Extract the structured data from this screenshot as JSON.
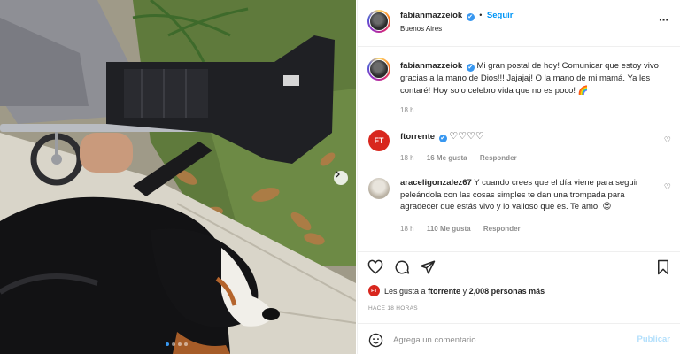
{
  "header": {
    "username": "fabianmazzeiok",
    "follow_label": "Seguir",
    "location": "Buenos Aires",
    "verified_icon": "✔"
  },
  "caption": {
    "username": "fabianmazzeiok",
    "text": "Mi gran postal de hoy! Comunicar que estoy vivo gracias a la mano de Dios!!! Jajajaj! O la mano de mi mamá. Ya les contaré! Hoy solo celebro vida que no es poco! 🌈",
    "time": "18 h"
  },
  "comments": [
    {
      "username": "ftorrente",
      "avatar_text": "FT",
      "text": "♡♡♡♡",
      "time": "18 h",
      "likes": "16 Me gusta",
      "reply_label": "Responder"
    },
    {
      "username": "araceligonzalez67",
      "text": "Y cuando crees que el día viene para seguir peleándola con las cosas simples te dan una trompada para agradecer que estás vivo y lo valioso que es. Te amo! 😍",
      "time": "18 h",
      "likes": "110 Me gusta",
      "reply_label": "Responder"
    }
  ],
  "likes_line": {
    "avatar_text": "FT",
    "prefix": "Les gusta a",
    "user": "ftorrente",
    "middle": "y",
    "count": "2,008 personas más"
  },
  "date_label": "HACE 18 HORAS",
  "comment_box": {
    "placeholder": "Agrega un comentario...",
    "post_label": "Publicar"
  },
  "icons": {
    "heart": "heart-icon",
    "comment": "comment-icon",
    "share": "share-icon",
    "save": "bookmark-icon",
    "emoji": "emoji-icon",
    "more": "more-options-icon",
    "next": "chevron-right-icon"
  },
  "carousel": {
    "count": 4,
    "active": 1
  },
  "colors": {
    "link_blue": "#0095f6",
    "verified_blue": "#3897f0",
    "muted": "#8e8e8e",
    "ft_red": "#d8271e"
  }
}
